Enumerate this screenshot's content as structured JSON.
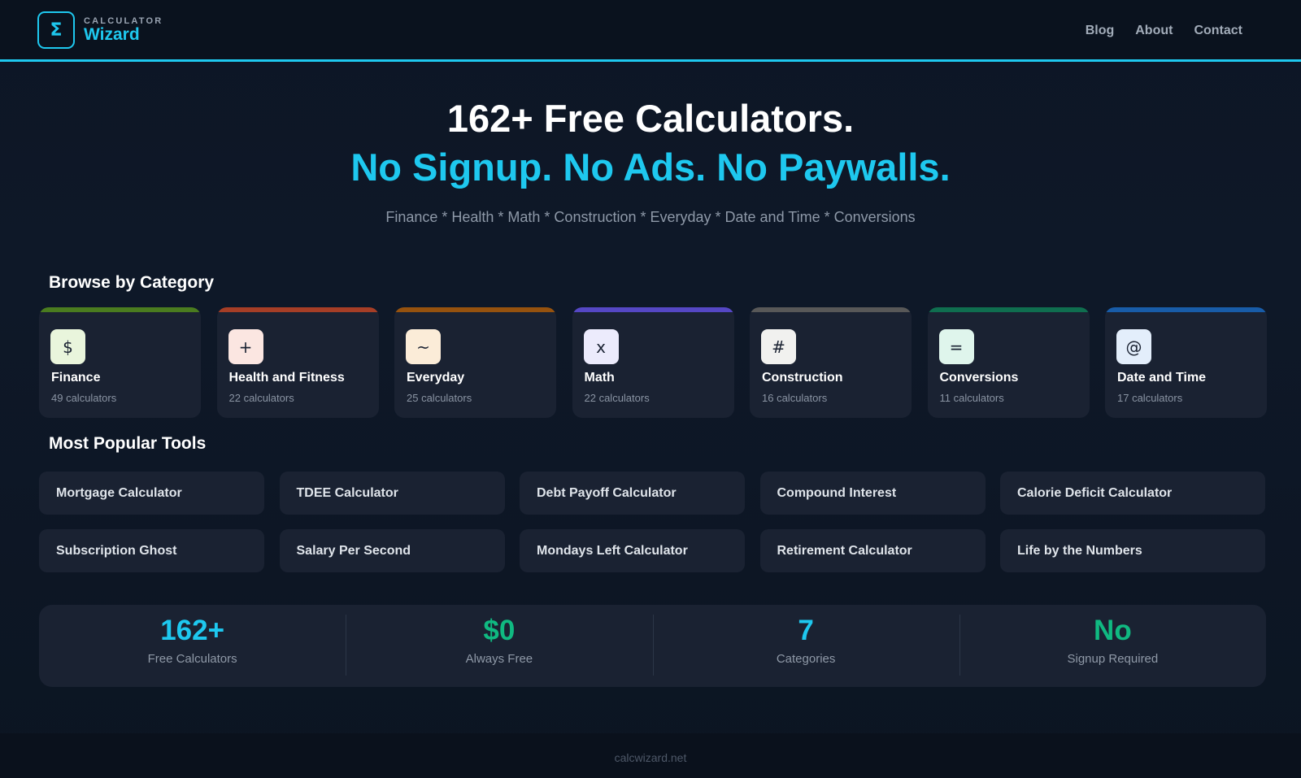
{
  "header": {
    "logo_symbol": "Σ",
    "logo_small": "CALCULATOR",
    "logo_big": "Wizard",
    "accent_color": "#1ec8ef",
    "nav": [
      "Blog",
      "About",
      "Contact"
    ]
  },
  "hero": {
    "title": "162+ Free Calculators.",
    "subtitle": "No Signup. No Ads. No Paywalls.",
    "categories_line": "Finance * Health * Math * Construction * Everyday * Date and Time * Conversions"
  },
  "browse": {
    "heading": "Browse by Category",
    "categories": [
      {
        "name": "Finance",
        "count": "49 calculators",
        "icon": "$",
        "icon_name": "dollar-icon",
        "bar_color": "#4a7c1f",
        "icon_bg": "#e9f5dc"
      },
      {
        "name": "Health and Fitness",
        "count": "22 calculators",
        "icon": "+",
        "icon_name": "plus-icon",
        "bar_color": "#a63e26",
        "icon_bg": "#fbe6e1"
      },
      {
        "name": "Everyday",
        "count": "25 calculators",
        "icon": "~",
        "icon_name": "tilde-icon",
        "bar_color": "#96520e",
        "icon_bg": "#fbecd8"
      },
      {
        "name": "Math",
        "count": "22 calculators",
        "icon": "x",
        "icon_name": "multiply-icon",
        "bar_color": "#5547c4",
        "icon_bg": "#ecebfc"
      },
      {
        "name": "Construction",
        "count": "16 calculators",
        "icon": "#",
        "icon_name": "hash-icon",
        "bar_color": "#585858",
        "icon_bg": "#f1f1ef"
      },
      {
        "name": "Conversions",
        "count": "11 calculators",
        "icon": "=",
        "icon_name": "equals-icon",
        "bar_color": "#0f6e4f",
        "icon_bg": "#dff5ec"
      },
      {
        "name": "Date and Time",
        "count": "17 calculators",
        "icon": "@",
        "icon_name": "at-icon",
        "bar_color": "#185ca8",
        "icon_bg": "#e3eefb"
      }
    ]
  },
  "popular": {
    "heading": "Most Popular Tools",
    "rows": [
      [
        "Mortgage Calculator",
        "TDEE Calculator",
        "Debt Payoff Calculator",
        "Compound Interest",
        "Calorie Deficit Calculator"
      ],
      [
        "Subscription Ghost",
        "Salary Per Second",
        "Mondays Left Calculator",
        "Retirement Calculator",
        "Life by the Numbers"
      ]
    ]
  },
  "stats": [
    {
      "value": "162+",
      "label": "Free Calculators",
      "color": "#1ec8ef"
    },
    {
      "value": "$0",
      "label": "Always Free",
      "color": "#10b981"
    },
    {
      "value": "7",
      "label": "Categories",
      "color": "#1ec8ef"
    },
    {
      "value": "No",
      "label": "Signup Required",
      "color": "#10b981"
    }
  ],
  "footer": {
    "text": "calcwizard.net"
  }
}
